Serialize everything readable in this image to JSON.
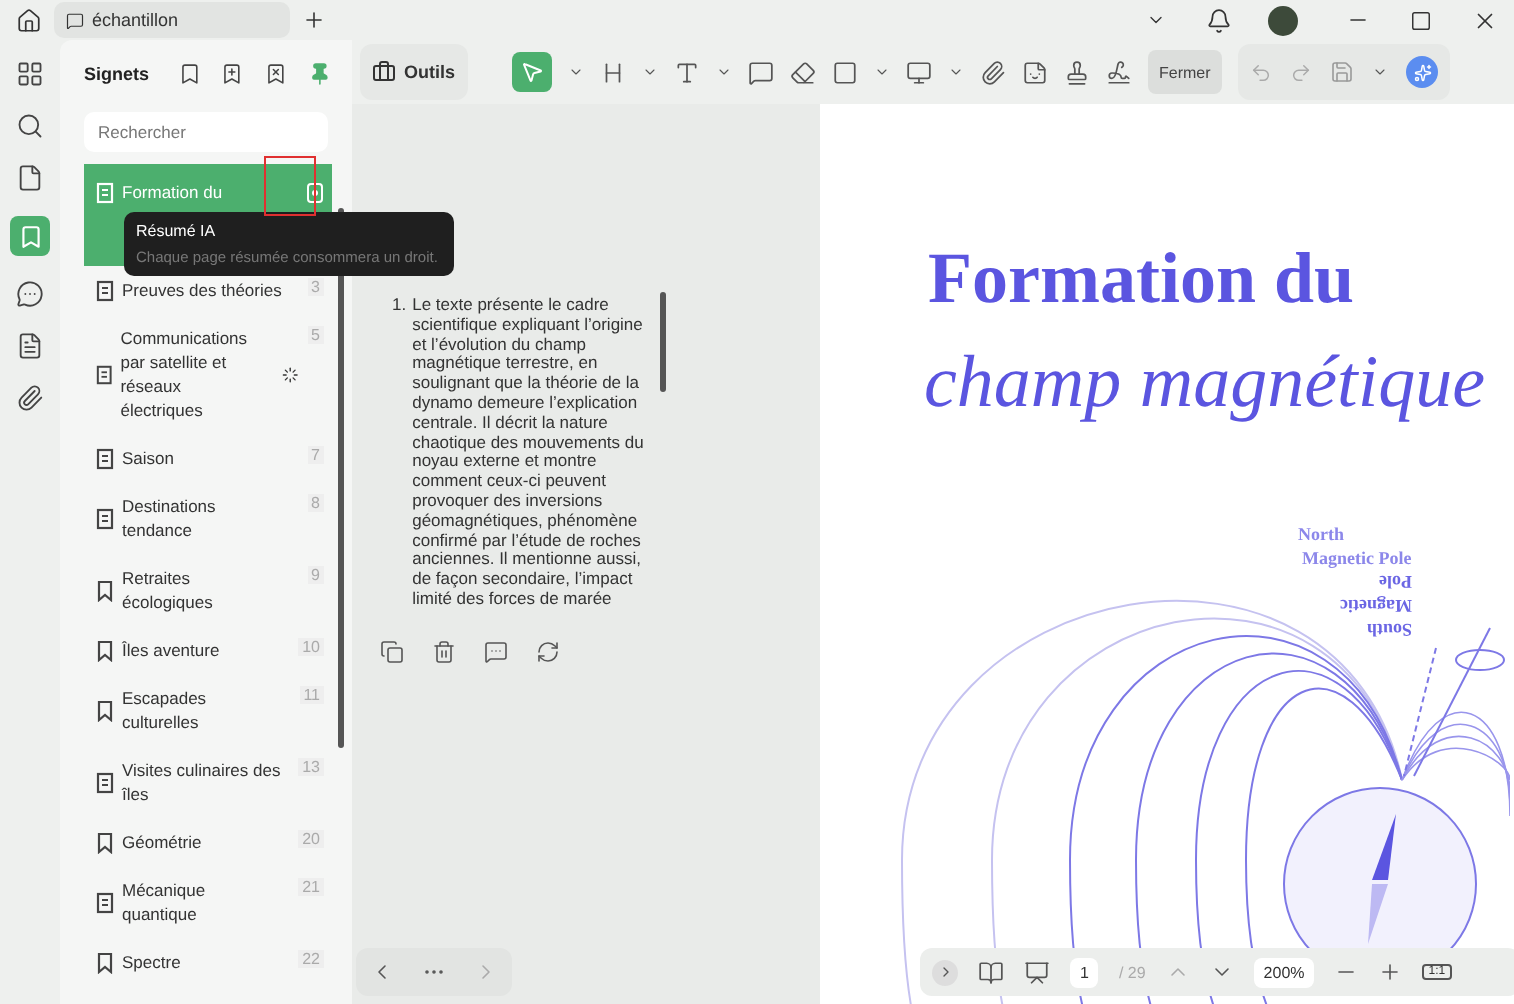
{
  "tab": {
    "title": "échantillon"
  },
  "panel": {
    "title": "Signets",
    "search_placeholder": "Rechercher"
  },
  "bookmarks": [
    {
      "label": "Formation du",
      "summarized": true,
      "selected": true,
      "loading": false
    },
    {
      "label": "Preuves des théories",
      "page": "3",
      "summarized": true,
      "selected": false,
      "loading": false
    },
    {
      "label": "Communications par satellite et réseaux électriques",
      "page": "5",
      "summarized": true,
      "selected": false,
      "loading": true
    },
    {
      "label": "Saison",
      "page": "7",
      "summarized": true,
      "selected": false,
      "loading": false
    },
    {
      "label": "Destinations tendance",
      "page": "8",
      "summarized": true,
      "selected": false,
      "loading": false
    },
    {
      "label": "Retraites écologiques",
      "page": "9",
      "summarized": false,
      "selected": false,
      "loading": false
    },
    {
      "label": "Îles aventure",
      "page": "10",
      "summarized": false,
      "selected": false,
      "loading": false
    },
    {
      "label": "Escapades culturelles",
      "page": "11",
      "summarized": false,
      "selected": false,
      "loading": false
    },
    {
      "label": "Visites culinaires des îles",
      "page": "13",
      "summarized": true,
      "selected": false,
      "loading": false
    },
    {
      "label": "Géométrie",
      "page": "20",
      "summarized": false,
      "selected": false,
      "loading": false
    },
    {
      "label": "Mécanique quantique",
      "page": "21",
      "summarized": true,
      "selected": false,
      "loading": false
    },
    {
      "label": "Spectre",
      "page": "22",
      "summarized": false,
      "selected": false,
      "loading": false
    }
  ],
  "tooltip": {
    "title": "Résumé IA",
    "text": "Chaque page résumée consommera un droit."
  },
  "toolbar": {
    "tools_label": "Outils",
    "close_label": "Fermer"
  },
  "summary": {
    "items": [
      {
        "number": "1.",
        "text": "Le texte présente le cadre scientifique expliquant l’origine et l’évolution du champ magnétique terrestre, en soulignant que la théorie de la dynamo demeure l’explication centrale. Il décrit la nature chaotique des mouvements du noyau externe et montre comment ceux-ci peuvent provoquer des inversions géomagnétiques, phénomène confirmé par l’étude de roches anciennes. Il mentionne aussi, de façon secondaire, l’impact limité des forces de marée"
      }
    ]
  },
  "document": {
    "title_line_1": "Formation du",
    "title_line_2": "champ magnétique",
    "north_label": [
      "North",
      "Magnetic Pole"
    ],
    "south_label": [
      "South",
      "Magnetic",
      "Pole"
    ]
  },
  "page_bar": {
    "page": "1",
    "total": "/ 29",
    "zoom": "200%",
    "fit": "1:1"
  }
}
